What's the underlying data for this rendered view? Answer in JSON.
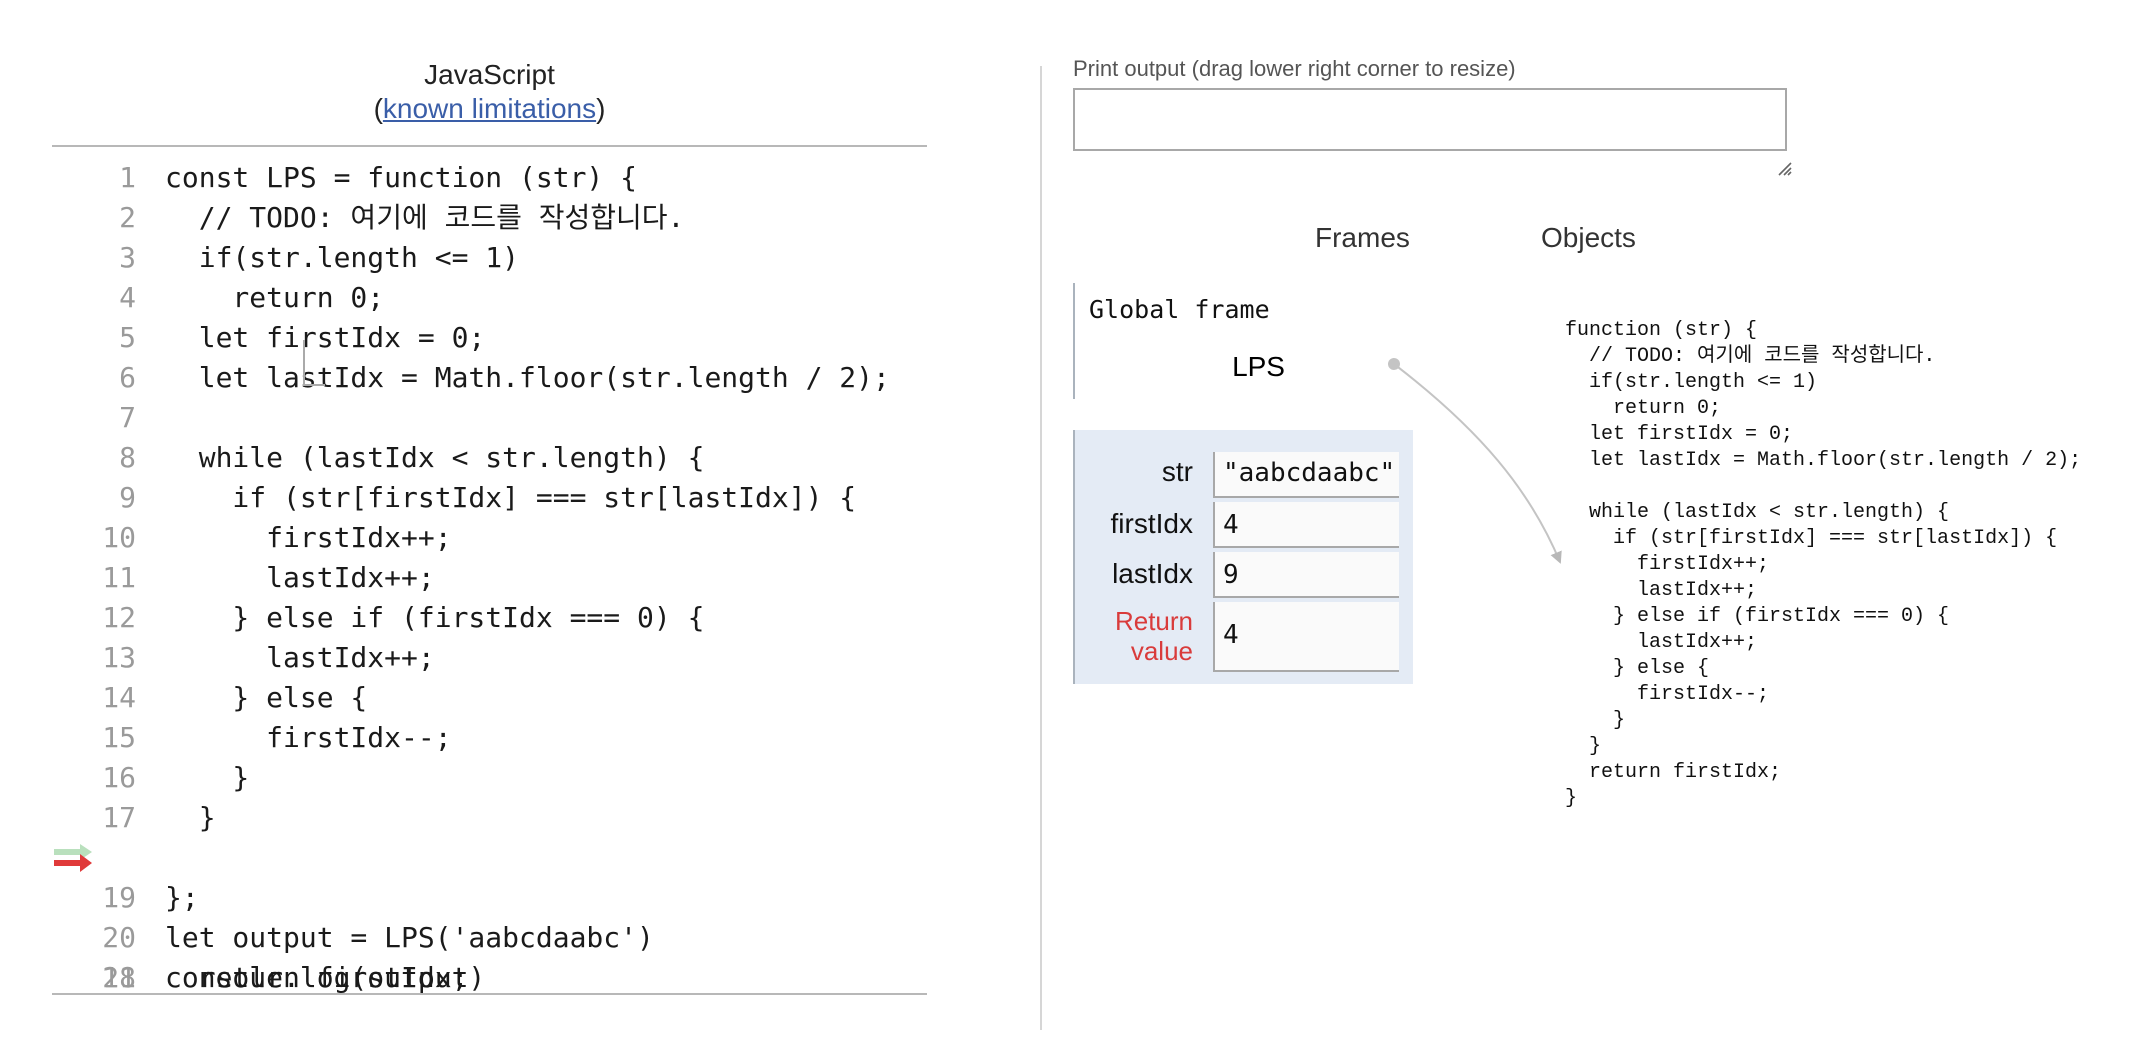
{
  "code_panel": {
    "language": "JavaScript",
    "limitations_open": "(",
    "limitations_link": "known limitations",
    "limitations_close": ")",
    "lines": [
      {
        "num": "1",
        "code": "const LPS = function (str) {"
      },
      {
        "num": "2",
        "code": "  // TODO: 여기에 코드를 작성합니다."
      },
      {
        "num": "3",
        "code": "  if(str.length <= 1)"
      },
      {
        "num": "4",
        "code": "    return 0;"
      },
      {
        "num": "5",
        "code": "  let firstIdx = 0;"
      },
      {
        "num": "6",
        "code": "  let lastIdx = Math.floor(str.length / 2);"
      },
      {
        "num": "7",
        "code": ""
      },
      {
        "num": "8",
        "code": "  while (lastIdx < str.length) {"
      },
      {
        "num": "9",
        "code": "    if (str[firstIdx] === str[lastIdx]) {"
      },
      {
        "num": "10",
        "code": "      firstIdx++;"
      },
      {
        "num": "11",
        "code": "      lastIdx++;"
      },
      {
        "num": "12",
        "code": "    } else if (firstIdx === 0) {"
      },
      {
        "num": "13",
        "code": "      lastIdx++;"
      },
      {
        "num": "14",
        "code": "    } else {"
      },
      {
        "num": "15",
        "code": "      firstIdx--;"
      },
      {
        "num": "16",
        "code": "    }"
      },
      {
        "num": "17",
        "code": "  }"
      },
      {
        "num": "18",
        "code": "  return firstIdx;"
      },
      {
        "num": "19",
        "code": "};"
      },
      {
        "num": "20",
        "code": "let output = LPS('aabcdaabc')"
      },
      {
        "num": "21",
        "code": "console.log(output)"
      }
    ],
    "current_line": "18",
    "arrow_colors": {
      "previous": "#b9e0bd",
      "current": "#e03a3a"
    }
  },
  "print_output": {
    "label": "Print output (drag lower right corner to resize)",
    "value": ""
  },
  "visualizer": {
    "frames_header": "Frames",
    "objects_header": "Objects",
    "global_frame": {
      "title": "Global frame",
      "variables": [
        {
          "name": "LPS",
          "value": "function pointer"
        }
      ]
    },
    "call_frame": {
      "variables": [
        {
          "name": "str",
          "value": "\"aabcdaabc\""
        },
        {
          "name": "firstIdx",
          "value": "4"
        },
        {
          "name": "lastIdx",
          "value": "9"
        }
      ],
      "return_label_1": "Return",
      "return_label_2": "value",
      "return_value": "4"
    },
    "function_object": {
      "lines": [
        "function (str) {",
        "  // TODO: 여기에 코드를 작성합니다.",
        "  if(str.length <= 1)",
        "    return 0;",
        "  let firstIdx = 0;",
        "  let lastIdx = Math.floor(str.length / 2);",
        "",
        "  while (lastIdx < str.length) {",
        "    if (str[firstIdx] === str[lastIdx]) {",
        "      firstIdx++;",
        "      lastIdx++;",
        "    } else if (firstIdx === 0) {",
        "      lastIdx++;",
        "    } else {",
        "      firstIdx--;",
        "    }",
        "  }",
        "  return firstIdx;",
        "}"
      ]
    }
  },
  "colors": {
    "frame_bg": "#e4ebf5",
    "return_label": "#d93b3b",
    "link": "#3a5ea8"
  }
}
